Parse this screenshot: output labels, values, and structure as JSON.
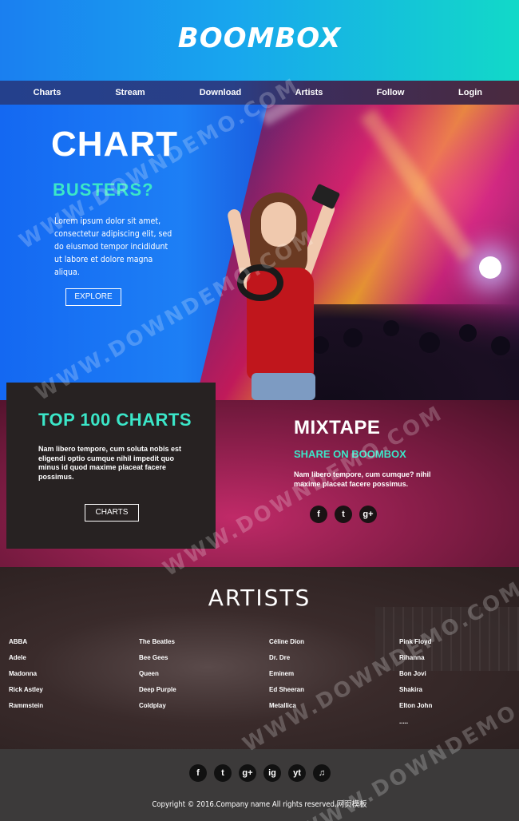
{
  "header": {
    "brand": "BOOMBOX"
  },
  "nav": {
    "items": [
      "Charts",
      "Stream",
      "Download",
      "Artists",
      "Follow",
      "Login"
    ]
  },
  "hero": {
    "title": "CHART",
    "subtitle": "BUSTERS?",
    "text": "Lorem ipsum dolor sit amet, consectetur adipiscing elit, sed do eiusmod tempor incididunt ut labore et dolore magna aliqua.",
    "button": "EXPLORE"
  },
  "charts_box": {
    "title": "TOP 100 CHARTS",
    "text": "Nam libero tempore, cum soluta nobis est eligendi optio cumque nihil impedit quo minus id quod maxime placeat facere possimus.",
    "button": "CHARTS"
  },
  "mixtape": {
    "title": "MIXTAPE",
    "subtitle": "SHARE ON BOOMBOX",
    "text": "Nam libero tempore, cum cumque? nihil maxime placeat facere possimus.",
    "social": [
      "f",
      "t",
      "g+"
    ]
  },
  "artists": {
    "title": "ARTISTS",
    "columns": [
      [
        "ABBA",
        "Adele",
        "Madonna",
        "Rick Astley",
        "Rammstein"
      ],
      [
        "The Beatles",
        "Bee Gees",
        "Queen",
        "Deep Purple",
        "Coldplay"
      ],
      [
        "Céline Dion",
        "Dr. Dre",
        "Eminem",
        "Ed Sheeran",
        "Metallica"
      ],
      [
        "Pink Floyd",
        "Rihanna",
        "Bon Jovi",
        "Shakira",
        "Elton John",
        "....."
      ]
    ]
  },
  "footer": {
    "social": [
      "f",
      "t",
      "g+",
      "ig",
      "yt",
      "♫"
    ],
    "copyright": "Copyright © 2016.Company name All rights reserved.网页模板"
  },
  "watermark": "WWW.DOWNDEMO.COM",
  "colors": {
    "accent": "#3be6c8",
    "header_start": "#1a7ff0",
    "header_end": "#12d9c8",
    "footer": "#3c3a3a"
  }
}
